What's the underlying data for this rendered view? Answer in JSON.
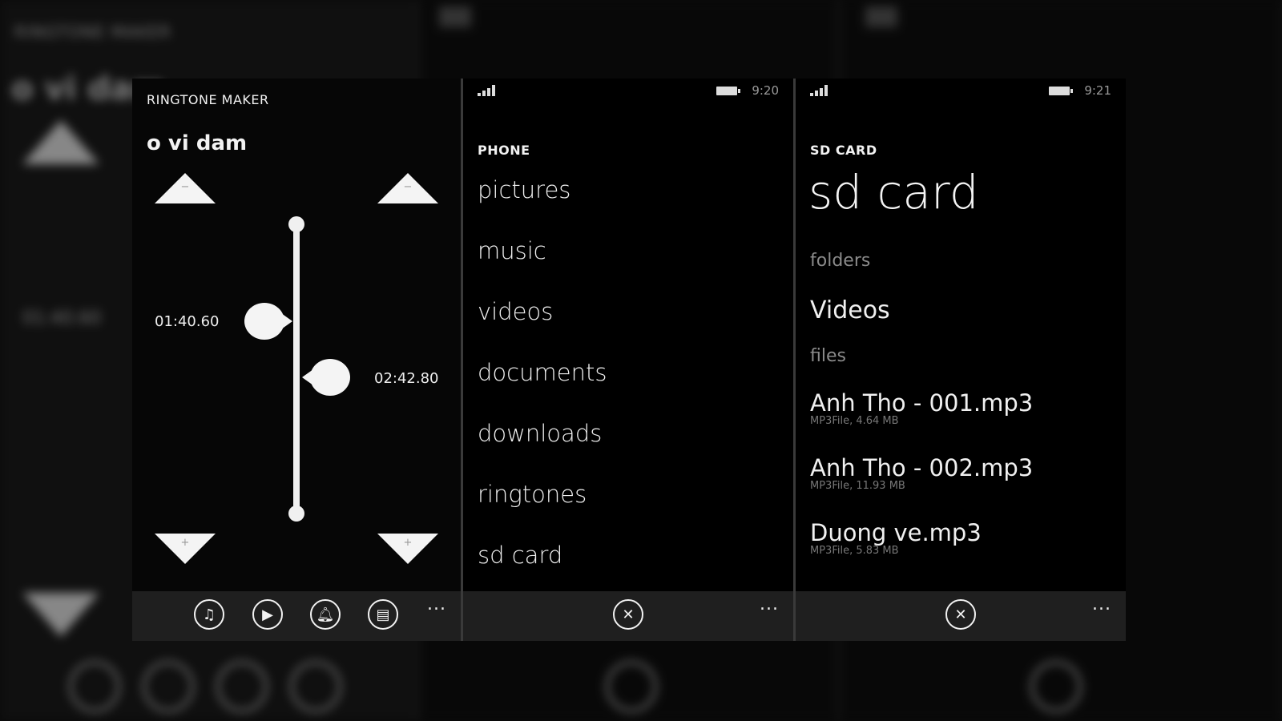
{
  "background": {
    "title": "RINGTONE MAKER",
    "song": "o vi dam",
    "time": "01:40.60"
  },
  "ringtone_panel": {
    "app_title": "RINGTONE MAKER",
    "song_title": "o vi dam",
    "start_time": "01:40.60",
    "end_time": "02:42.80",
    "icons": [
      "music-note-icon",
      "play-icon",
      "bell-icon",
      "save-icon"
    ],
    "more": "..."
  },
  "phone_panel": {
    "status_time": "9:20",
    "title": "PHONE",
    "items": [
      "pictures",
      "music",
      "videos",
      "documents",
      "downloads",
      "ringtones",
      "sd card"
    ],
    "more": "..."
  },
  "sdcard_panel": {
    "status_time": "9:21",
    "title": "SD CARD",
    "heading": "sd card",
    "folders_label": "folders",
    "folders": [
      "Videos"
    ],
    "files_label": "files",
    "files": [
      {
        "name": "Anh Tho - 001.mp3",
        "meta": "MP3File, 4.64 MB"
      },
      {
        "name": "Anh Tho - 002.mp3",
        "meta": "MP3File, 11.93 MB"
      },
      {
        "name": "Duong ve.mp3",
        "meta": "MP3File, 5.83 MB"
      }
    ],
    "more": "..."
  }
}
